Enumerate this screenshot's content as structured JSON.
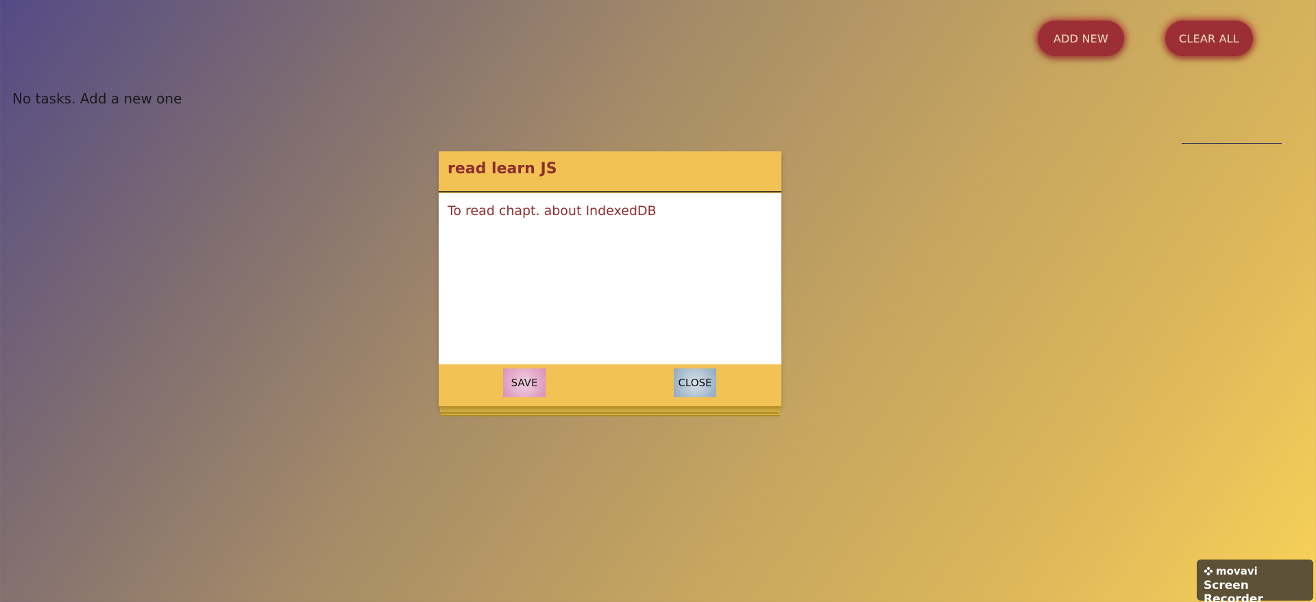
{
  "header": {
    "add_new_label": "ADD NEW",
    "clear_all_label": "CLEAR ALL"
  },
  "tasks": {
    "empty_message": "No tasks. Add a new one"
  },
  "modal": {
    "title": "read learn JS",
    "body": "To read chapt. about IndexedDB",
    "save_label": "SAVE",
    "close_label": "CLOSE"
  },
  "watermark": {
    "brand": "movavi",
    "product": "Screen Recorder"
  },
  "colors": {
    "accent_button": "#9c2f36",
    "modal_background": "#f2c255",
    "modal_text": "#8e2e2f"
  }
}
